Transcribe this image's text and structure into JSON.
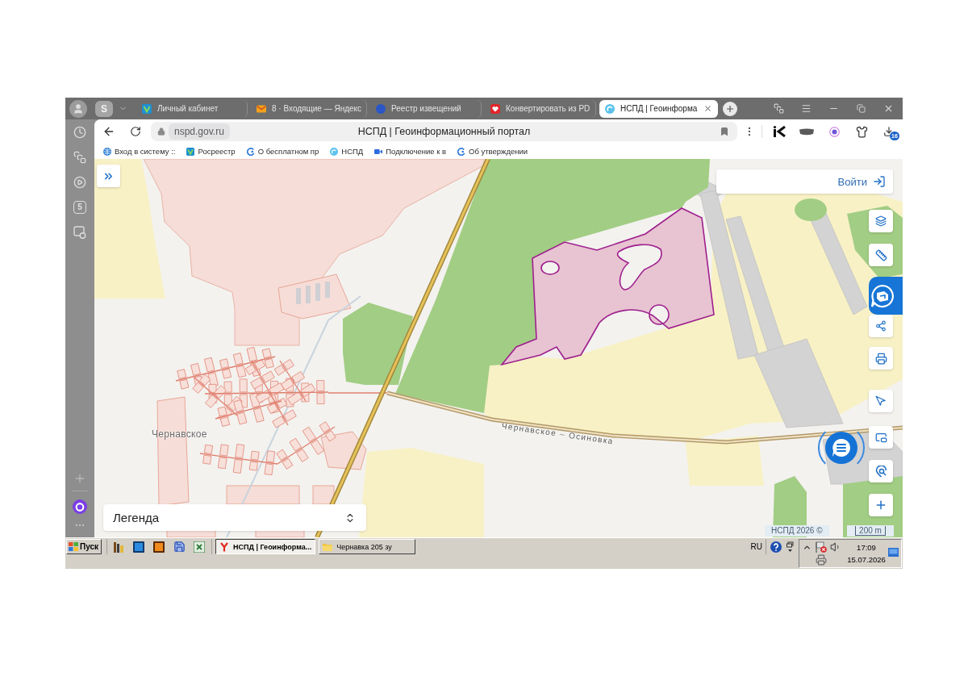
{
  "tab_bar": {
    "workspace_badge": "S",
    "tabs": [
      {
        "kind": "emblem",
        "title": "Личный кабинет",
        "selected": false
      },
      {
        "kind": "envelope",
        "title": "8 · Входящие — Яндекс",
        "selected": false
      },
      {
        "kind": "dot",
        "title": "Реестр извещений",
        "selected": false
      },
      {
        "kind": "heart",
        "title": "Конвертировать из PD",
        "selected": false
      },
      {
        "kind": "swirl",
        "title": "НСПД | Геоинформа",
        "selected": true
      }
    ]
  },
  "sidebar": {
    "app_badge": "5"
  },
  "toolbar": {
    "url": "nspd.gov.ru",
    "page_title": "НСПД | Геоинформационный портал",
    "download_count": "16"
  },
  "bookmarks": [
    {
      "kind": "globe",
      "label": "Вход в систему ::"
    },
    {
      "kind": "emblem",
      "label": "Росреестр"
    },
    {
      "kind": "arc",
      "label": "О бесплатном пр"
    },
    {
      "kind": "swirl",
      "label": "НСПД"
    },
    {
      "kind": "camera",
      "label": "Подключение к в"
    },
    {
      "kind": "arc",
      "label": "Об утверждении"
    }
  ],
  "map": {
    "login_label": "Войти",
    "place_label": "Чернавское",
    "road_label": "Чернавское – Осиновка",
    "legend_label": "Легенда",
    "attribution": "НСПД 2026 ©",
    "scale": "200 m"
  },
  "taskbar": {
    "start_label": "Пуск",
    "tasks": [
      {
        "kind": "browser",
        "title": "НСПД | Геоинформа...",
        "selected": true
      },
      {
        "kind": "folder",
        "title": "Чернавка 205 зу",
        "selected": false
      }
    ],
    "language": "RU",
    "time": "17:09",
    "date": "15.07.2026"
  }
}
